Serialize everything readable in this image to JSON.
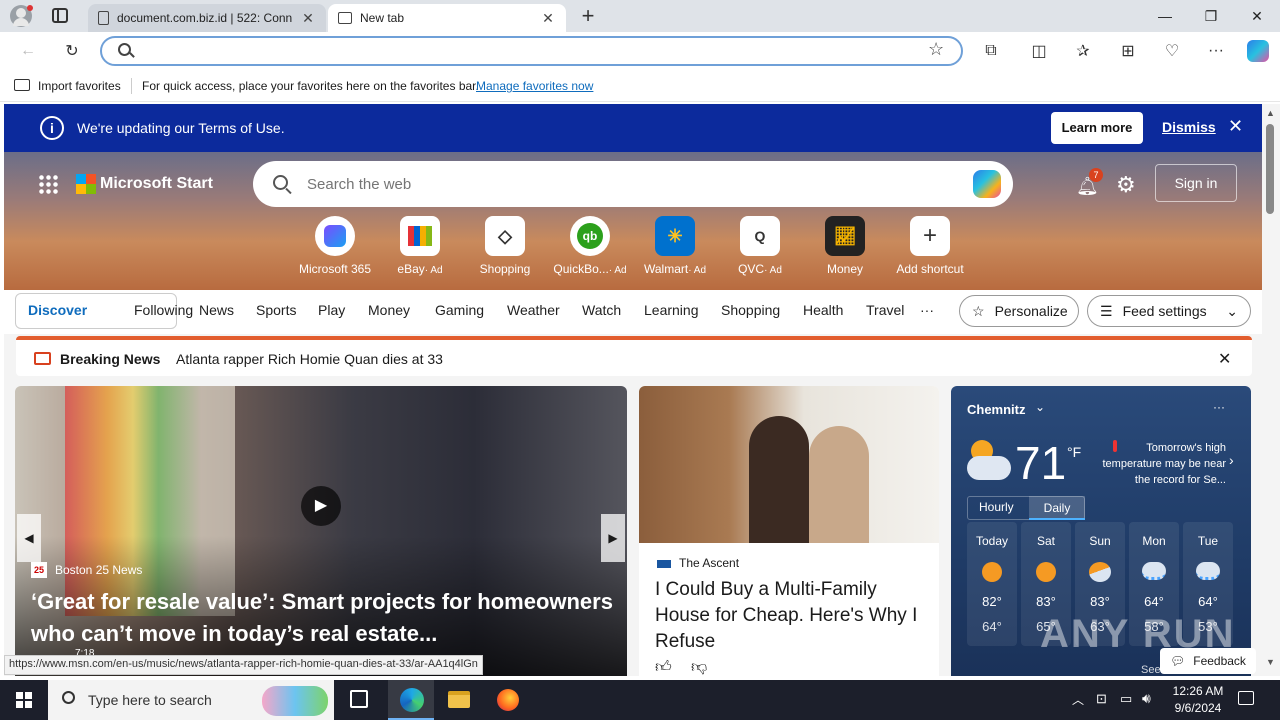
{
  "tabs": [
    {
      "title": "document.com.biz.id | 522: Conn",
      "close": "✕"
    },
    {
      "title": "New tab",
      "close": "✕"
    }
  ],
  "new_tab": "+",
  "address": {
    "value": "",
    "placeholder": ""
  },
  "favorites": {
    "import_label": "Import favorites",
    "message": "For quick access, place your favorites here on the favorites bar.",
    "manage_link": "Manage favorites now"
  },
  "banner": {
    "message": "We're updating our Terms of Use.",
    "learn_more": "Learn more",
    "dismiss": "Dismiss"
  },
  "msn": {
    "brand": "Microsoft Start",
    "search_placeholder": "Search the web",
    "notification_count": "7",
    "sign_in": "Sign in",
    "shortcuts": [
      {
        "label": "Microsoft 365",
        "ad": ""
      },
      {
        "label": "eBay",
        "ad": "· Ad"
      },
      {
        "label": "Shopping",
        "ad": ""
      },
      {
        "label": "QuickBo...",
        "ad": "· Ad"
      },
      {
        "label": "Walmart",
        "ad": "· Ad"
      },
      {
        "label": "QVC",
        "ad": "· Ad"
      },
      {
        "label": "Money",
        "ad": ""
      },
      {
        "label": "Add shortcut",
        "ad": ""
      }
    ]
  },
  "categories": {
    "discover": "Discover",
    "following": "Following",
    "items": [
      "News",
      "Sports",
      "Play",
      "Money",
      "Gaming",
      "Weather",
      "Watch",
      "Learning",
      "Shopping",
      "Health",
      "Travel"
    ],
    "more": "···",
    "personalize": "Personalize",
    "feed_settings": "Feed settings"
  },
  "breaking": {
    "label": "Breaking News",
    "headline": "Atlanta rapper Rich Homie Quan dies at 33"
  },
  "main_story": {
    "source": "Boston 25 News",
    "headline": "‘Great for resale value’: Smart projects for homeowners who can’t move in today’s real estate...",
    "duration": "7:18"
  },
  "side_story": {
    "source": "The Ascent",
    "headline": "I Could Buy a Multi-Family House for Cheap. Here's Why I Refuse"
  },
  "weather": {
    "city": "Chemnitz",
    "temp": "71",
    "unit": "°F",
    "alert": "Tomorrow's high temperature may be near the record for Se...",
    "tab_hourly": "Hourly",
    "tab_daily": "Daily",
    "days": [
      {
        "name": "Today",
        "high": "82°",
        "low": "64°",
        "icon": "sun-icon"
      },
      {
        "name": "Sat",
        "high": "83°",
        "low": "65°",
        "icon": "sun-icon"
      },
      {
        "name": "Sun",
        "high": "83°",
        "low": "63°",
        "icon": "partly-cloudy-icon"
      },
      {
        "name": "Mon",
        "high": "64°",
        "low": "58°",
        "icon": "rain-icon"
      },
      {
        "name": "Tue",
        "high": "64°",
        "low": "53°",
        "icon": "rain-icon"
      }
    ],
    "see_more": "See full forecast"
  },
  "feedback": "Feedback",
  "status_url": "https://www.msn.com/en-us/music/news/atlanta-rapper-rich-homie-quan-dies-at-33/ar-AA1q4lGn",
  "watermark": "ANY RUN",
  "taskbar": {
    "search_placeholder": "Type here to search",
    "time": "12:26 AM",
    "date": "9/6/2024"
  },
  "colors": {
    "accent": "#0c2a9c",
    "link": "#0f6cbd",
    "breaking": "#e25d2e"
  }
}
